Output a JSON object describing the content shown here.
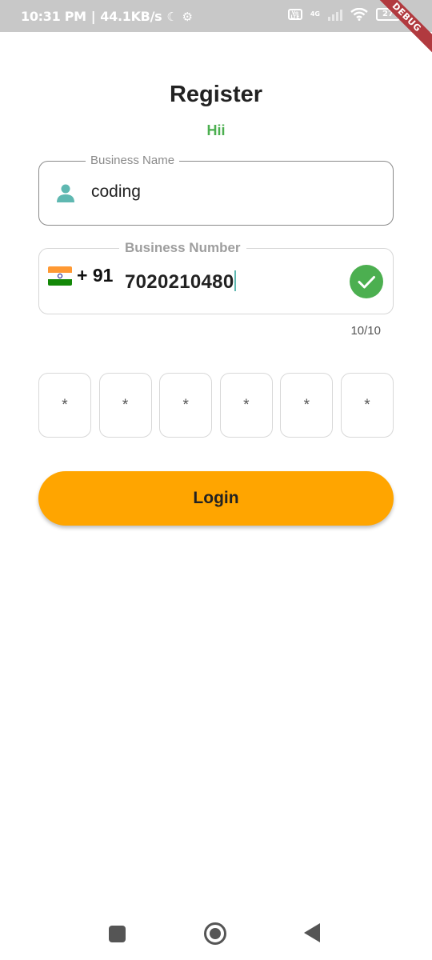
{
  "status_bar": {
    "time": "10:31 PM",
    "net_speed": "44.1KB/s",
    "volte": "VoLTE",
    "network": "4G",
    "battery": "27",
    "icons": [
      "moon-icon",
      "gear-icon",
      "volte-icon",
      "signal-icon",
      "wifi-icon",
      "battery-icon"
    ]
  },
  "debug_banner": "DEBUG",
  "header": {
    "title": "Register",
    "subtitle": "Hii"
  },
  "business_name": {
    "label": "Business Name",
    "value": "coding",
    "icon": "person-icon"
  },
  "business_number": {
    "label": "Business Number",
    "country_flag": "india-flag-icon",
    "country_code": "+ 91",
    "value": "7020210480",
    "counter": "10/10",
    "valid_icon": "check-circle-icon"
  },
  "otp": {
    "boxes": [
      "*",
      "*",
      "*",
      "*",
      "*",
      "*"
    ]
  },
  "login_button": {
    "label": "Login"
  },
  "colors": {
    "accent_green": "#4caf50",
    "button_orange": "#ffa500",
    "icon_teal": "#5fb8b1",
    "status_bar_gray": "#c8c8c8"
  },
  "nav_bar": {
    "items": [
      "recent-apps-icon",
      "home-icon",
      "back-icon"
    ]
  }
}
